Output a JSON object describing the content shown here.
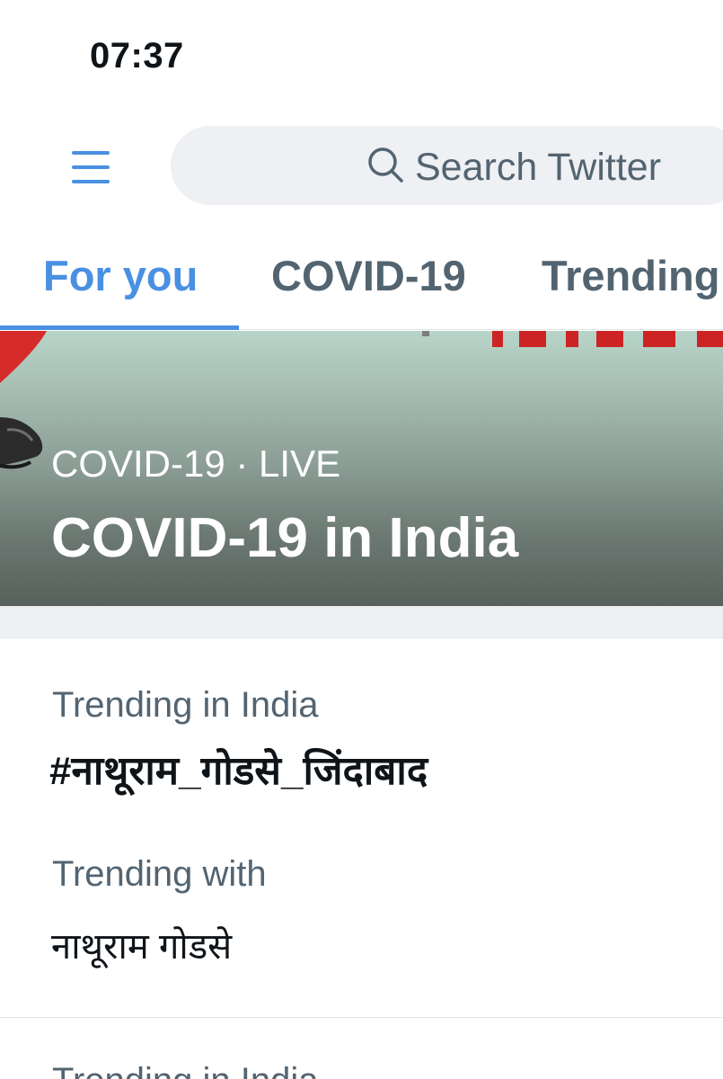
{
  "status_bar": {
    "time": "07:37"
  },
  "header": {
    "menu_icon": "hamburger-menu-icon",
    "search": {
      "placeholder": "Search Twitter",
      "icon": "search-icon"
    }
  },
  "tabs": [
    {
      "label": "For you",
      "active": true
    },
    {
      "label": "COVID-19",
      "active": false
    },
    {
      "label": "Trending",
      "active": false
    }
  ],
  "hero": {
    "meta": "COVID-19 · LIVE",
    "title": "COVID-19 in India"
  },
  "trends": [
    {
      "context": "Trending in India",
      "tag": "#नाथूराम_गोडसे_जिंदाबाद",
      "with_label": "Trending with",
      "with_value": "नाथूराम गोडसे"
    },
    {
      "context": "Trending in India"
    }
  ],
  "colors": {
    "accent": "#4a90e2",
    "text_primary": "#0f1419",
    "text_secondary": "#536471",
    "search_bg": "#eef0f3",
    "divider": "#e1e5e8"
  }
}
